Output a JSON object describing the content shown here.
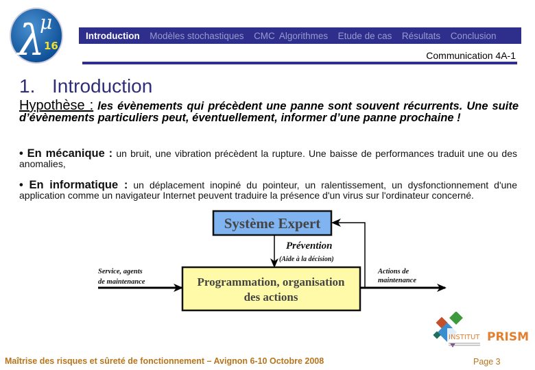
{
  "logo": {
    "badge": "16",
    "symbol": "λμ"
  },
  "nav": {
    "tabs": [
      {
        "label": "Introduction",
        "active": true
      },
      {
        "label": "Modèles stochastiques",
        "active": false
      },
      {
        "label": "CMC",
        "active": false
      },
      {
        "label": "Algorithmes",
        "active": false
      },
      {
        "label": "Etude de cas",
        "active": false
      },
      {
        "label": "Résultats",
        "active": false
      },
      {
        "label": "Conclusion",
        "active": false
      }
    ]
  },
  "header": {
    "subtitle": "Communication 4A-1"
  },
  "title": {
    "number": "1.",
    "text": "Introduction"
  },
  "hypothesis": {
    "label": "Hypothèse :",
    "text": " les évènements qui précèdent une panne sont souvent récurrents. Une suite d’évènements particuliers peut, éventuellement, informer d’une panne prochaine !"
  },
  "bullets": [
    {
      "head": "• En mécanique :",
      "text": " un bruit, une vibration précèdent la rupture. Une baisse de performances traduit une ou des anomalies,"
    },
    {
      "head": "• En informatique :",
      "text": " un déplacement inopiné du pointeur, un ralentissement, un dysfonctionnement d'une application comme un navigateur Internet peuvent traduire la présence d'un virus sur l'ordinateur concerné."
    }
  ],
  "diagram": {
    "expert_box": "Système Expert",
    "action_box_line1": "Programmation, organisation",
    "action_box_line2": "des actions",
    "prevention": "Prévention",
    "prevention_sub": "(Aide à la décision)",
    "input_line1": "Service, agents",
    "input_line2": "de maintenance",
    "output_line1": "Actions de",
    "output_line2": "maintenance",
    "colors": {
      "expert_fill": "#80b4f0",
      "action_fill": "#fffaa8",
      "text": "#444444"
    }
  },
  "brand": {
    "institut": "INSTITUT",
    "name": "PRISME"
  },
  "footer": {
    "text": "Maîtrise des risques et sûreté de fonctionnement – Avignon  6-10 Octobre 2008",
    "page": "Page 3"
  },
  "colors": {
    "nav_bg": "#2e2e8c",
    "title": "#2e2e7a",
    "footer": "#b8741a"
  }
}
